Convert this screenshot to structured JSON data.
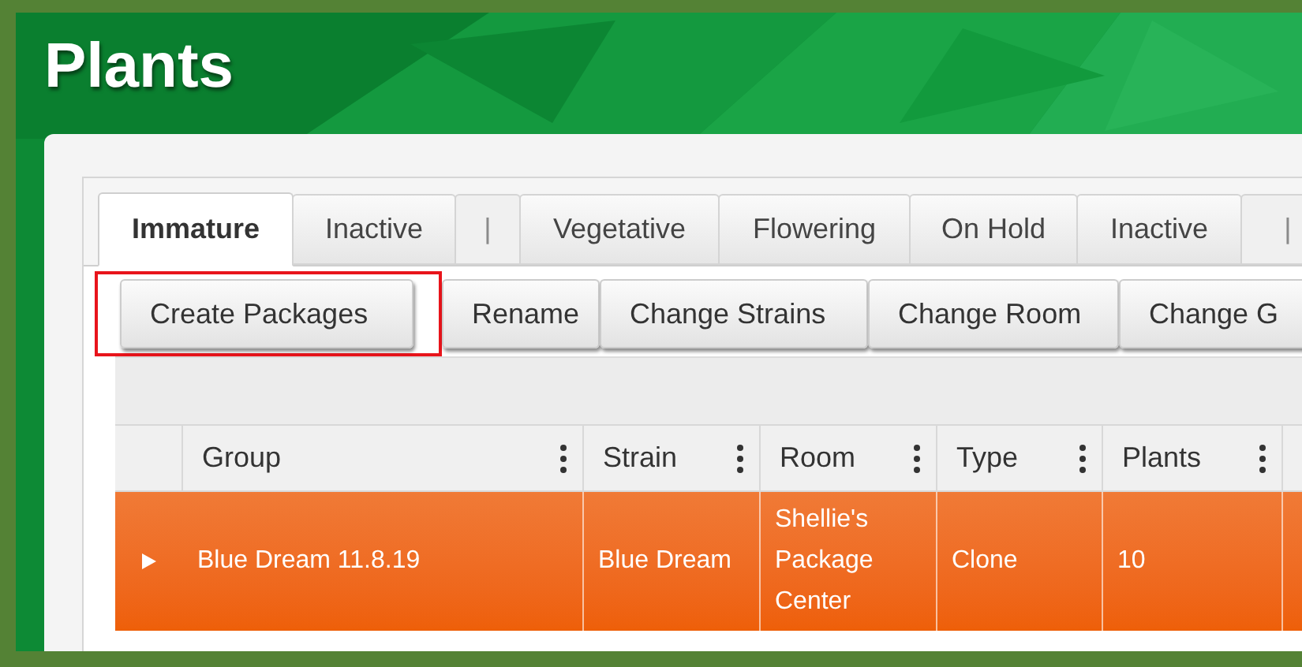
{
  "page": {
    "title": "Plants"
  },
  "tabs": [
    {
      "kind": "tab",
      "label": "Immature",
      "selected": true
    },
    {
      "kind": "tab",
      "label": "Inactive",
      "selected": false
    },
    {
      "kind": "separator",
      "label": "|"
    },
    {
      "kind": "tab",
      "label": "Vegetative",
      "selected": false
    },
    {
      "kind": "tab",
      "label": "Flowering",
      "selected": false
    },
    {
      "kind": "tab",
      "label": "On Hold",
      "selected": false
    },
    {
      "kind": "tab",
      "label": "Inactive",
      "selected": false
    },
    {
      "kind": "separator",
      "label": "|"
    }
  ],
  "actions": [
    {
      "label": "Create Packages",
      "highlighted": true
    },
    {
      "label": "Rename",
      "highlighted": false
    },
    {
      "label": "Change Strains",
      "highlighted": false
    },
    {
      "label": "Change Room",
      "highlighted": false
    },
    {
      "label": "Change G",
      "highlighted": false
    }
  ],
  "table": {
    "columns": [
      "Group",
      "Strain",
      "Room",
      "Type",
      "Plants"
    ],
    "rows": [
      {
        "selected": true,
        "expanded": false,
        "cells": [
          "Blue Dream 11.8.19",
          "Blue Dream",
          "Shellie's Package Center",
          "Clone",
          "10"
        ]
      }
    ]
  }
}
